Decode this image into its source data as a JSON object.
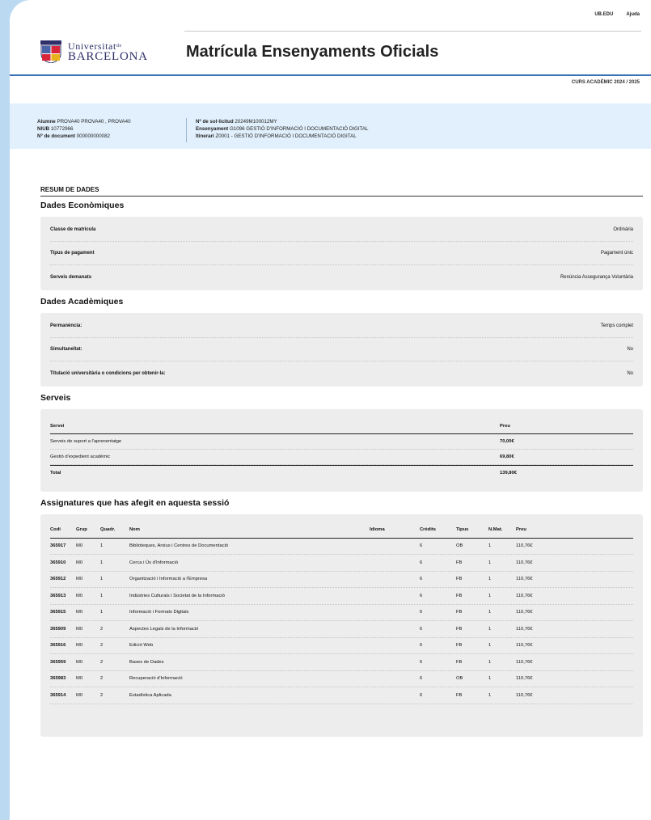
{
  "top_links": [
    "UB.EDU",
    "Ajuda"
  ],
  "logo": {
    "line1": "Universitat",
    "line1_small": "de",
    "line2": "BARCELONA"
  },
  "app_title": "Matrícula Ensenyaments Oficials",
  "course": "CURS ACADÈMIC 2024 / 2025",
  "student": {
    "alumne_label": "Alumne",
    "alumne": "PROVA40 PROVA40 , PROVA40",
    "niub_label": "NIUB",
    "niub": "10772966",
    "doc_label": "Nº de document",
    "doc": "000000000082"
  },
  "request": {
    "sol_label": "Nº de sol·licitud",
    "sol": "20249M100012MY",
    "ens_label": "Ensenyament",
    "ens": "G1096 GESTIÓ D'INFORMACIÓ I DOCUMENTACIÓ DIGITAL",
    "itin_label": "Itinerari",
    "itin": "Z0001 - GESTIÓ D'INFORMACIÓ I DOCUMENTACIÓ DIGITAL"
  },
  "resum": "RESUM DE DADES",
  "economiques": {
    "title": "Dades Econòmiques",
    "rows": [
      {
        "k": "Classe de matrícula",
        "v": "Ordinària"
      },
      {
        "k": "Tipus de pagament",
        "v": "Pagament únic"
      },
      {
        "k": "Serveis demanats",
        "v": "Renúncia Assegurança Voluntària"
      }
    ]
  },
  "academiques": {
    "title": "Dades Acadèmiques",
    "rows": [
      {
        "k": "Permanència:",
        "v": "Temps complet"
      },
      {
        "k": "Simultaneïtat:",
        "v": "No"
      },
      {
        "k": "Titulació universitària o condicions per obtenir-la:",
        "v": "No"
      }
    ]
  },
  "serveis": {
    "title": "Serveis",
    "headers": [
      "Servei",
      "Preu"
    ],
    "rows": [
      {
        "servei": "Serveis de suport a l'aprenentatge",
        "preu": "70,00€"
      },
      {
        "servei": "Gestió d'expedient acadèmic",
        "preu": "69,80€"
      }
    ],
    "total_label": "Total",
    "total": "139,80€"
  },
  "assignatures": {
    "title": "Assignatures que has afegit en aquesta sessió",
    "headers": [
      "Codi",
      "Grup",
      "Quadr.",
      "Nom",
      "Idioma",
      "Crèdits",
      "Tipus",
      "N.Mat.",
      "Preu"
    ],
    "rows": [
      [
        "365917",
        "M0",
        "1",
        "Biblioteques, Arxius i Centres de Documentació",
        "",
        "6",
        "OB",
        "1",
        "110,76€"
      ],
      [
        "365910",
        "M0",
        "1",
        "Cerca i Ús d'Informació",
        "",
        "6",
        "FB",
        "1",
        "110,76€"
      ],
      [
        "365912",
        "M0",
        "1",
        "Organització i Informació a l'Empresa",
        "",
        "6",
        "FB",
        "1",
        "110,76€"
      ],
      [
        "365913",
        "M0",
        "1",
        "Indústries Culturals i Societat de la Informació",
        "",
        "6",
        "FB",
        "1",
        "110,76€"
      ],
      [
        "365915",
        "M0",
        "1",
        "Informació i Formats Digitals",
        "",
        "6",
        "FB",
        "1",
        "110,76€"
      ],
      [
        "365909",
        "M0",
        "2",
        "Aspectes Legals de la Informació",
        "",
        "6",
        "FB",
        "1",
        "110,76€"
      ],
      [
        "365916",
        "M0",
        "2",
        "Edició Web",
        "",
        "6",
        "FB",
        "1",
        "110,76€"
      ],
      [
        "365959",
        "M0",
        "2",
        "Bases de Dades",
        "",
        "6",
        "FB",
        "1",
        "110,76€"
      ],
      [
        "365983",
        "M0",
        "2",
        "Recuperació d'Informació",
        "",
        "6",
        "OB",
        "1",
        "110,76€"
      ],
      [
        "365914",
        "M0",
        "2",
        "Estadística Aplicada",
        "",
        "6",
        "FB",
        "1",
        "110,76€"
      ]
    ]
  },
  "colors": {
    "accent": "#3a73b8",
    "band": "#e1f0fc",
    "frame": "#bcd9f2",
    "logo": "#2f2f6a"
  }
}
